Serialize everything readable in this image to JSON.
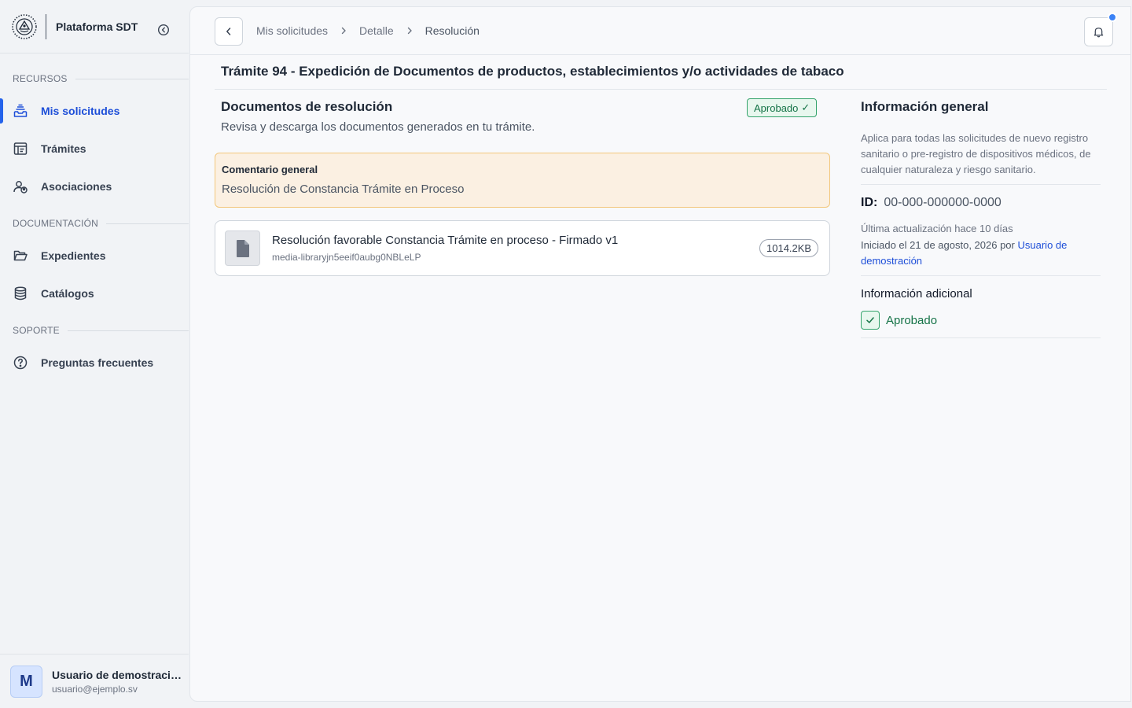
{
  "app": {
    "title": "Plataforma SDT"
  },
  "sidebar": {
    "sections": [
      {
        "label": "RECURSOS"
      },
      {
        "label": "DOCUMENTACIÓN"
      },
      {
        "label": "SOPORTE"
      }
    ],
    "items": [
      {
        "label": "Mis solicitudes",
        "icon": "inbox-stack-icon",
        "active": true
      },
      {
        "label": "Trámites",
        "icon": "calendar-table-icon"
      },
      {
        "label": "Asociaciones",
        "icon": "user-group-icon"
      },
      {
        "label": "Expedientes",
        "icon": "folder-open-icon"
      },
      {
        "label": "Catálogos",
        "icon": "database-icon"
      },
      {
        "label": "Preguntas frecuentes",
        "icon": "question-circle-icon"
      }
    ],
    "user": {
      "initial": "M",
      "name": "Usuario de demostración",
      "email": "usuario@ejemplo.sv"
    }
  },
  "topbar": {
    "breadcrumb": [
      "Mis solicitudes",
      "Detalle",
      "Resolución"
    ],
    "has_notification": true
  },
  "page": {
    "title": "Trámite 94 - Expedición de Documentos de productos, establecimientos y/o actividades de tabaco"
  },
  "documents": {
    "title": "Documentos de resolución",
    "subtitle": "Revisa y descarga los documentos generados en tu trámite.",
    "status": "Aprobado",
    "status_mark": "✓",
    "comment": {
      "title": "Comentario general",
      "text": "Resolución de Constancia Trámite en Proceso"
    },
    "files": [
      {
        "name": "Resolución favorable Constancia Trámite en proceso - Firmado v1",
        "path": "media-libraryjn5eeif0aubg0NBLeLP",
        "size": "1014.2KB"
      }
    ]
  },
  "info": {
    "title": "Información general",
    "description": "Aplica para todas las solicitudes de nuevo registro sanitario o pre-registro de dispositivos médicos, de cualquier naturaleza y riesgo sanitario.",
    "id_label": "ID:",
    "id_value": "00-000-000000-0000",
    "updated": "Última actualización hace 10 días",
    "started_prefix": "Iniciado el 21 de agosto, 2026 por",
    "started_by": "Usuario de demostración",
    "additional_title": "Información adicional",
    "additional_status": "Aprobado"
  },
  "colors": {
    "accent": "#2563eb",
    "success": "#157347",
    "warning_bg": "#fbf0e2",
    "warning_border": "#f2c77c"
  }
}
